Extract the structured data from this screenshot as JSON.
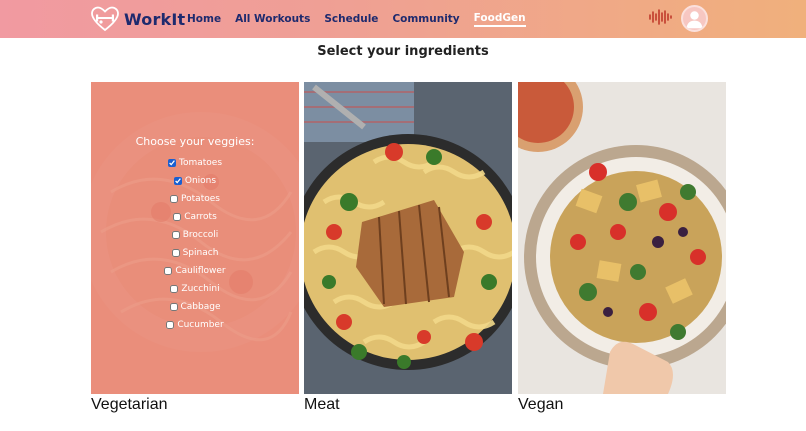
{
  "app": {
    "brand_name": "WorkIt"
  },
  "nav": {
    "items": [
      {
        "label": "Home"
      },
      {
        "label": "All Workouts"
      },
      {
        "label": "Schedule"
      },
      {
        "label": "Community"
      },
      {
        "label": "FoodGen"
      }
    ],
    "active": "FoodGen"
  },
  "page": {
    "title": "Select your ingredients"
  },
  "cards": {
    "vegetarian": {
      "label": "Vegetarian",
      "veggies_title": "Choose your veggies:",
      "veggies": [
        {
          "label": "Tomatoes",
          "checked": true
        },
        {
          "label": "Onions",
          "checked": true
        },
        {
          "label": "Potatoes",
          "checked": false
        },
        {
          "label": "Carrots",
          "checked": false
        },
        {
          "label": "Broccoli",
          "checked": false
        },
        {
          "label": "Spinach",
          "checked": false
        },
        {
          "label": "Cauliflower",
          "checked": false
        },
        {
          "label": "Zucchini",
          "checked": false
        },
        {
          "label": "Cabbage",
          "checked": false
        },
        {
          "label": "Cucumber",
          "checked": false
        }
      ]
    },
    "meat": {
      "label": "Meat"
    },
    "vegan": {
      "label": "Vegan"
    }
  },
  "colors": {
    "nav_gradient_start": "#f19aa1",
    "nav_gradient_end": "#f0b07c",
    "nav_text": "#1e2a6e",
    "veg_overlay": "#ea8e7c"
  }
}
